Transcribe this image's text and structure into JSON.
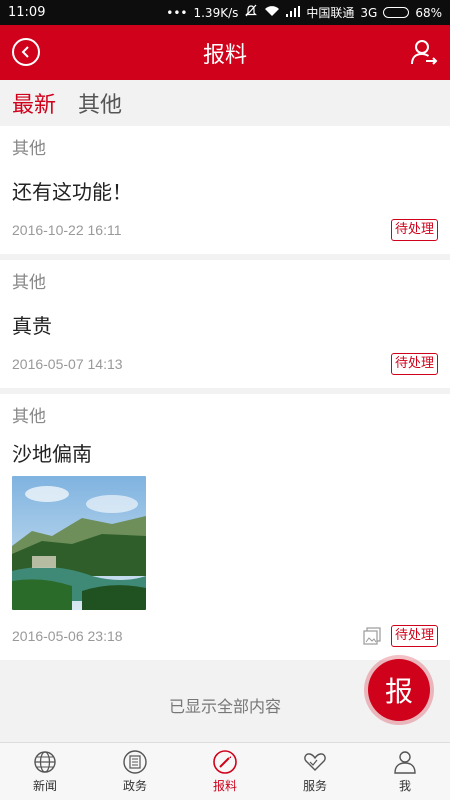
{
  "status_bar": {
    "time": "11:09",
    "dots": "•••",
    "speed": "1.39K/s",
    "carrier": "中国联通",
    "network": "3G",
    "battery_percent": "68%",
    "battery_level": 0.68
  },
  "header": {
    "title": "报料"
  },
  "tabs": [
    {
      "label": "最新",
      "active": true
    },
    {
      "label": "其他",
      "active": false
    }
  ],
  "items": [
    {
      "category": "其他",
      "headline": "还有这功能！",
      "date": "2016-10-22 16:11",
      "status": "待处理"
    },
    {
      "category": "其他",
      "headline": "真贵",
      "date": "2016-05-07 14:13",
      "status": "待处理"
    },
    {
      "category": "其他",
      "headline": "沙地偏南",
      "date": "2016-05-06 23:18",
      "status": "待处理",
      "has_image": true
    }
  ],
  "footer_note": "已显示全部内容",
  "fab_label": "报",
  "bottom_nav": [
    {
      "label": "新闻",
      "icon": "globe-icon"
    },
    {
      "label": "政务",
      "icon": "document-icon"
    },
    {
      "label": "报料",
      "icon": "compass-edit-icon",
      "active": true
    },
    {
      "label": "服务",
      "icon": "heart-hands-icon"
    },
    {
      "label": "我",
      "icon": "person-icon"
    }
  ],
  "colors": {
    "brand": "#d0021b",
    "background": "#f2f2f2"
  }
}
